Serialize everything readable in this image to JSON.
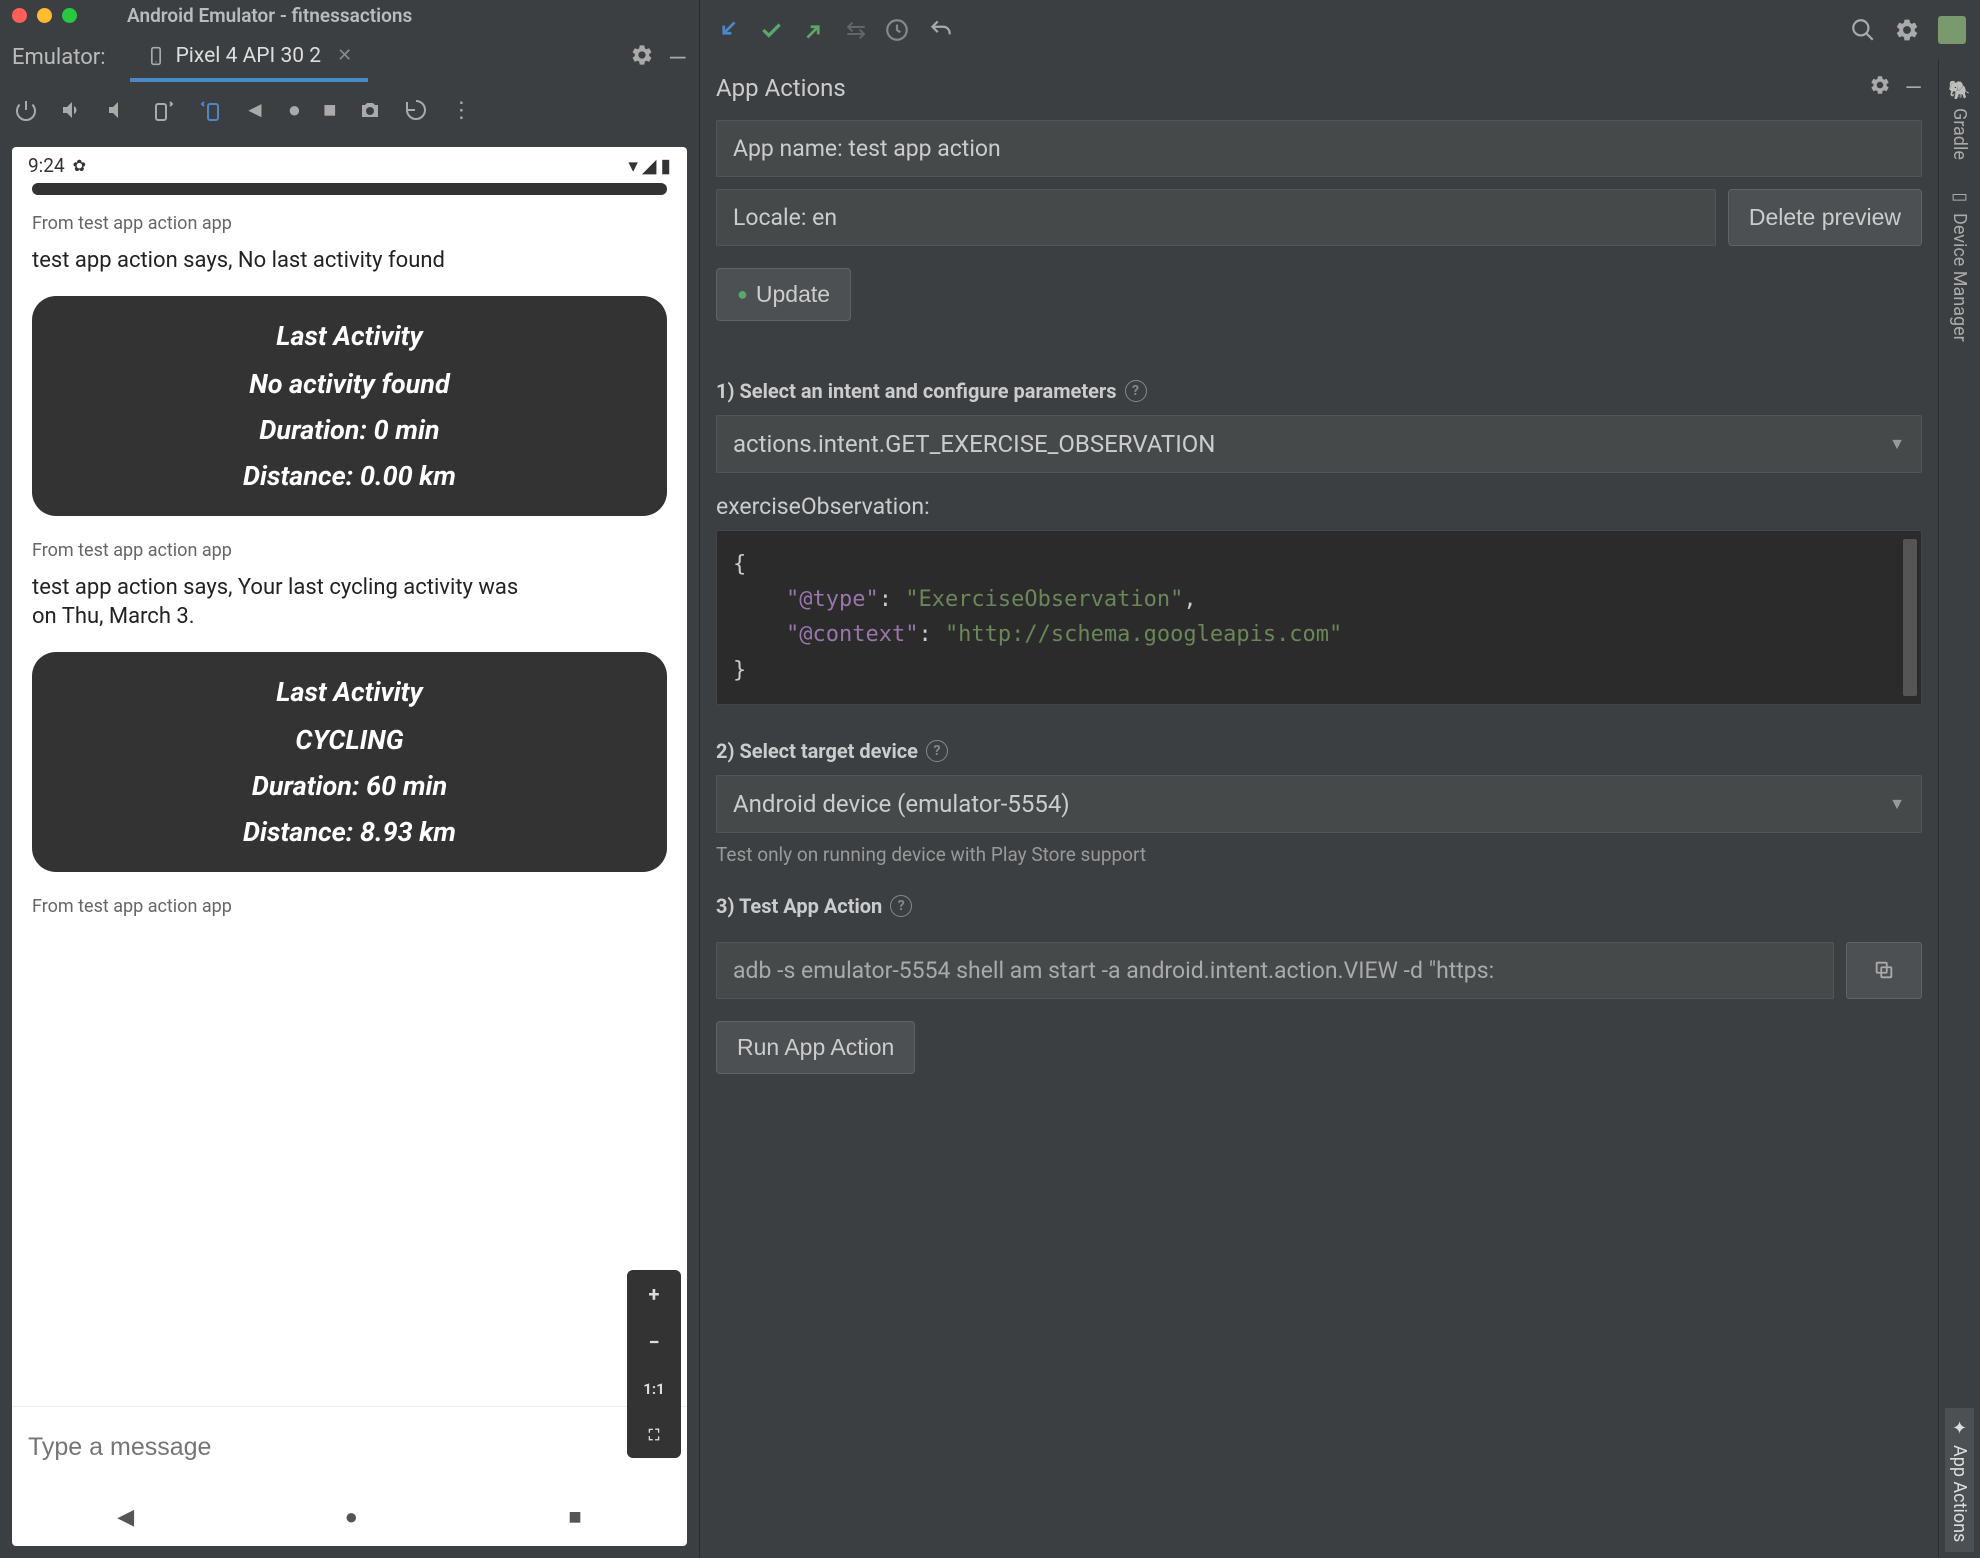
{
  "window_title": "Android Emulator - fitnessactions",
  "emulator": {
    "label": "Emulator:",
    "tab": "Pixel 4 API 30 2"
  },
  "phone": {
    "time": "9:24",
    "msg_placeholder": "Type a message",
    "messages": [
      {
        "from": "From test app action app",
        "text": "test app action says, No last activity found"
      },
      {
        "from": "From test app action app",
        "text": "test app action says, Your last cycling activity was on Thu, March 3."
      },
      {
        "from": "From test app action app",
        "text": ""
      }
    ],
    "cards": [
      {
        "title": "Last Activity",
        "line1": "No activity found",
        "line2": "Duration: 0 min",
        "line3": "Distance: 0.00 km"
      },
      {
        "title": "Last Activity",
        "line1": "CYCLING",
        "line2": "Duration: 60 min",
        "line3": "Distance: 8.93 km"
      }
    ],
    "zoom": {
      "plus": "+",
      "minus": "−",
      "ratio": "1:1"
    }
  },
  "panel": {
    "title": "App Actions",
    "app_name": "App name: test app action",
    "locale": "Locale: en",
    "delete_btn": "Delete preview",
    "update_btn": "Update",
    "step1_label": "1) Select an intent and configure parameters",
    "intent_value": "actions.intent.GET_EXERCISE_OBSERVATION",
    "param_label": "exerciseObservation:",
    "code_lines": {
      "l1": "{",
      "l2_k": "\"@type\"",
      "l2_v": "\"ExerciseObservation\"",
      "l3_k": "\"@context\"",
      "l3_v": "\"http://schema.googleapis.com\"",
      "l4": "}"
    },
    "step2_label": "2) Select target device",
    "device_value": "Android device (emulator-5554)",
    "device_hint": "Test only on running device with Play Store support",
    "step3_label": "3) Test App Action",
    "adb_cmd": "adb -s emulator-5554 shell am start -a android.intent.action.VIEW -d \"https:",
    "run_btn": "Run App Action"
  },
  "side": {
    "gradle": "Gradle",
    "device_mgr": "Device Manager",
    "app_actions": "App Actions"
  }
}
